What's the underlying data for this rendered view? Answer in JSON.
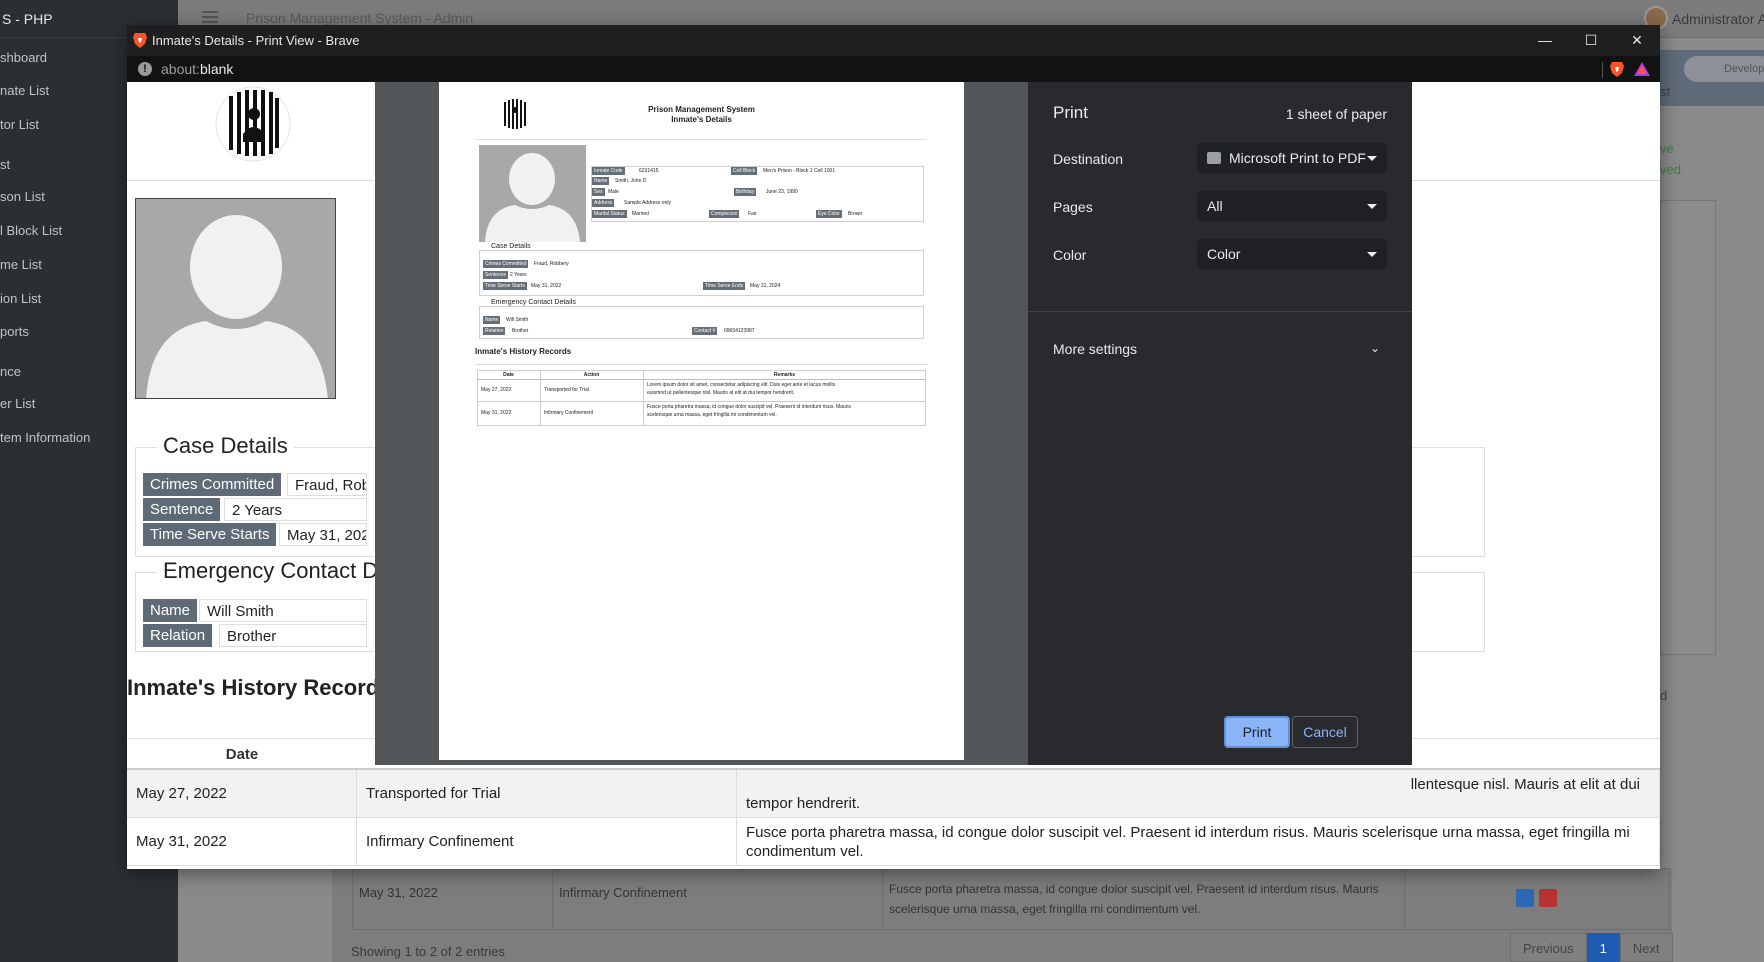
{
  "background_app": {
    "brand": "S - PHP",
    "app_title": "Prison Management System - Admin",
    "admin_name": "Administrator A",
    "sidebar_items": [
      "shboard",
      "nate List",
      "tor List",
      "st",
      "son List",
      "l Block List",
      "me List",
      "ion List",
      "ports",
      "nce",
      "er List",
      "tem Information"
    ],
    "developed_label": "Developed",
    "right_btn": "st",
    "right_text1": "ve",
    "right_text2": "ved",
    "right_d": "d",
    "table_row": {
      "date": "May 31, 2022",
      "action": "Infirmary Confinement",
      "remarks": "Fusce porta pharetra massa, id congue dolor suscipit vel. Praesent id interdum risus. Mauris scelerisque urna massa, eget fringilla mi condimentum vel."
    },
    "showing": "Showing 1 to 2 of 2 entries",
    "pager": {
      "previous": "Previous",
      "page": "1",
      "next": "Next"
    }
  },
  "window": {
    "title": "Inmate's Details - Print View - Brave",
    "url_scheme": "about:",
    "url_rest": "blank",
    "controls": {
      "minimize": "—",
      "maximize": "☐",
      "close": "✕"
    }
  },
  "page": {
    "case_details": {
      "legend": "Case Details",
      "crimes_label": "Crimes Committed",
      "crimes_value": "Fraud, Robb",
      "sentence_label": "Sentence",
      "sentence_value": "2 Years",
      "start_label": "Time Serve Starts",
      "start_value": "May 31, 2022"
    },
    "emergency": {
      "legend": "Emergency Contact D",
      "name_label": "Name",
      "name_value": "Will Smith",
      "relation_label": "Relation",
      "relation_value": "Brother"
    },
    "history_title": "Inmate's History Record",
    "table_header_date": "Date",
    "rows": [
      {
        "date": "May 27, 2022",
        "action": "Transported for Trial",
        "remarks_right": "llentesque nisl. Mauris at elit at dui",
        "remarks_line2": "tempor hendrerit."
      },
      {
        "date": "May 31, 2022",
        "action": "Infirmary Confinement",
        "remarks": "Fusce porta pharetra massa, id congue dolor suscipit vel. Praesent id interdum risus. Mauris scelerisque urna massa, eget fringilla mi condimentum vel."
      }
    ]
  },
  "print": {
    "title": "Print",
    "sheets": "1 sheet of paper",
    "destination_label": "Destination",
    "destination_value": "Microsoft Print to PDF",
    "pages_label": "Pages",
    "pages_value": "All",
    "color_label": "Color",
    "color_value": "Color",
    "more_settings": "More settings",
    "print_button": "Print",
    "cancel_button": "Cancel"
  },
  "preview": {
    "header_line1": "Prison Management System",
    "header_line2": "Inmate's Details",
    "inmate_code_label": "Inmate Code",
    "inmate_code": "6231415",
    "cell_block_label": "Cell Block",
    "cell_block": "Men's Prison - Block 1 Cell 1001",
    "name_label": "Name",
    "name": "Smith, John D",
    "sex_label": "Sex",
    "sex": "Male",
    "birthday_label": "Birthday",
    "birthday": "June 23, 1990",
    "address_label": "Address",
    "address": "Sample Address only",
    "marital_label": "Marital Status",
    "marital": "Married",
    "complexion_label": "Complexion",
    "complexion": "Fair",
    "eye_label": "Eye Color",
    "eye": "Brown",
    "case_legend": "Case Details",
    "crimes_label": "Crimes Committed",
    "crimes": "Fraud, Robbery",
    "sentence_label": "Sentence",
    "sentence": "2 Years",
    "start_label": "Time Serve Starts",
    "start": "May 31, 2022",
    "end_label": "Time Serve Ends",
    "end": "May 31, 2024",
    "emergency_legend": "Emergency Contact Details",
    "ec_name_label": "Name",
    "ec_name": "Will Smith",
    "ec_relation_label": "Relation",
    "ec_relation": "Brother",
    "ec_contact_label": "Contact #",
    "ec_contact": "09654123987",
    "history_title": "Inmate's History Records",
    "th_date": "Date",
    "th_action": "Action",
    "th_remarks": "Remarks",
    "r1_date": "May 27, 2022",
    "r1_action": "Transported for Trial",
    "r1_remarks_a": "Lorem ipsum dolor sit amet, consectetur adipiscing elit. Duis eget ante et lacus mollis",
    "r1_remarks_b": "euismod ut pellentesque nisl. Mauris at elit at dui tempor hendrerit.",
    "r2_date": "May 31, 2022",
    "r2_action": "Infirmary Confinement",
    "r2_remarks_a": "Fusce porta pharetra massa, id congue dolor suscipit vel. Praesent id interdum risus. Mauris",
    "r2_remarks_b": "scelerisque urna massa, eget fringilla mi condimentum vel."
  }
}
